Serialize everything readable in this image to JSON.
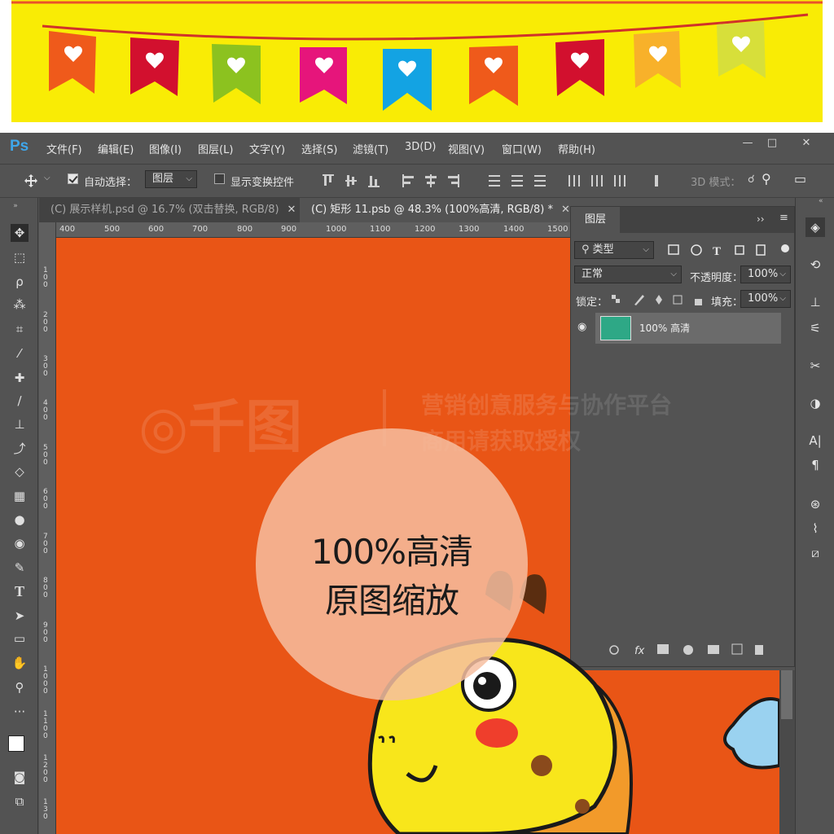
{
  "app": {
    "logo": "Ps",
    "menu": [
      "文件(F)",
      "编辑(E)",
      "图像(I)",
      "图层(L)",
      "文字(Y)",
      "选择(S)",
      "滤镜(T)",
      "3D(D)",
      "视图(V)",
      "窗口(W)",
      "帮助(H)"
    ],
    "window_controls": [
      "—",
      "□",
      "✕"
    ]
  },
  "options": {
    "auto_select_label": "自动选择：",
    "auto_select_value": "图层",
    "show_transform_label": "显示变换控件",
    "mode_3d_label": "3D 模式："
  },
  "tabs": [
    {
      "label": "(C) 展示样机.psd @ 16.7% (双击替换, RGB/8)",
      "close": "✕",
      "active": false
    },
    {
      "label": "(C) 矩形 11.psb @ 48.3% (100%高清, RGB/8) *",
      "close": "✕",
      "active": true
    }
  ],
  "ruler_h": [
    "400",
    "500",
    "600",
    "700",
    "800",
    "900",
    "1000",
    "1100",
    "1200",
    "1300",
    "1400",
    "1500"
  ],
  "ruler_v": [
    "1\n0\n0",
    "2\n0\n0",
    "3\n0\n0",
    "4\n0\n0",
    "5\n0\n0",
    "6\n0\n0",
    "7\n0\n0",
    "8\n0\n0",
    "9\n0\n0",
    "1\n0\n0\n0",
    "1\n1\n0\n0",
    "1\n2\n0\n0",
    "1\n3\n0"
  ],
  "layers_panel": {
    "title": "图层",
    "filter_label": "类型",
    "blend_mode": "正常",
    "opacity_label": "不透明度：",
    "opacity_value": "100%",
    "lock_label": "锁定：",
    "fill_label": "填充：",
    "fill_value": "100%",
    "layer_name": "100% 高清"
  },
  "watermark": {
    "brand": "千图",
    "line1": "营销创意服务与协作平台",
    "line2": "商用请获取授权"
  },
  "overlay": {
    "line1": "100%高清",
    "line2": "原图缩放"
  },
  "colors": {
    "canvas": "#e95516",
    "banner": "#f9ec05",
    "ps_accent": "#3fa6ea",
    "layer_thumb": "#2ea886"
  }
}
